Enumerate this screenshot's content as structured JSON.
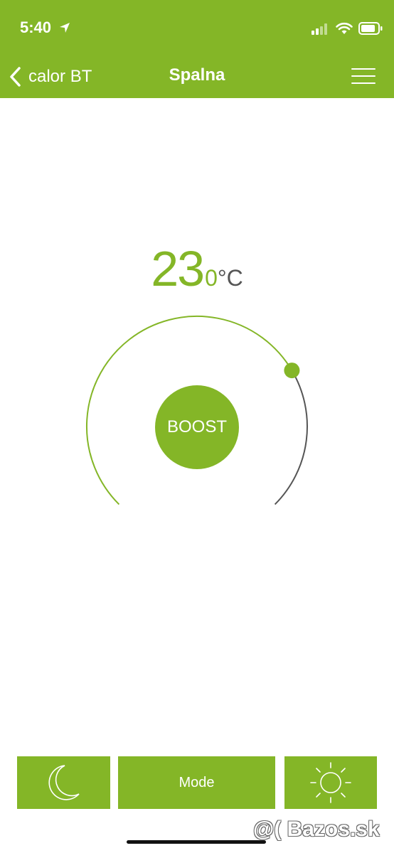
{
  "status_bar": {
    "time": "5:40",
    "icons": [
      "location-arrow-icon",
      "cellular-signal-icon",
      "wifi-icon",
      "battery-icon"
    ]
  },
  "nav": {
    "back_label": "calor BT",
    "title": "Spalna",
    "menu_icon": "hamburger-menu-icon"
  },
  "thermostat": {
    "temperature": "23",
    "decimal": "0",
    "unit": "°C",
    "boost_label": "BOOST",
    "dial_fraction": 0.72
  },
  "bottom_bar": {
    "night_icon": "moon-icon",
    "mode_label": "Mode",
    "day_icon": "sun-icon"
  },
  "watermark": "@( Bazos.sk",
  "colors": {
    "accent": "#84b627",
    "track": "#555555",
    "background": "#ffffff"
  }
}
